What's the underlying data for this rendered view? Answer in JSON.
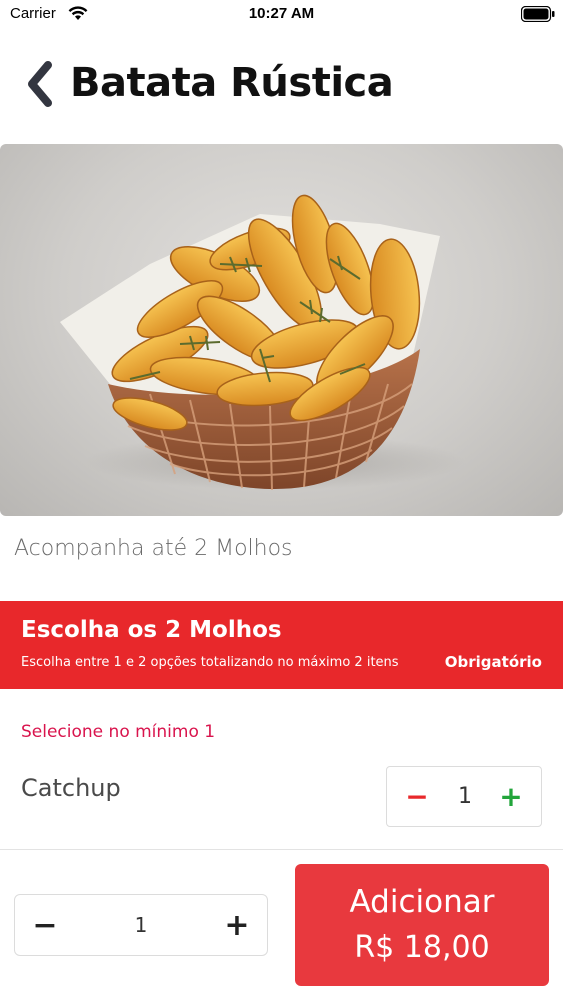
{
  "status_bar": {
    "carrier": "Carrier",
    "time": "10:27 AM",
    "icons": [
      "wifi-icon",
      "battery-icon"
    ]
  },
  "header": {
    "back_icon": "chevron-left-icon",
    "title": "Batata Rústica"
  },
  "product": {
    "image": "fried-potato-wedges-basket-photo",
    "description": "Acompanha até 2 Molhos"
  },
  "section": {
    "title": "Escolha os 2 Molhos",
    "subtitle": "Escolha entre 1 e 2 opções totalizando no máximo 2 itens",
    "badge": "Obrigatório",
    "color": "#e8282b"
  },
  "options": {
    "min_note": "Selecione no mínimo 1",
    "items": [
      {
        "name": "Catchup",
        "quantity": "1",
        "minus": "−",
        "plus": "+"
      }
    ]
  },
  "footer": {
    "quantity": "1",
    "minus": "−",
    "plus": "+",
    "add_label": "Adicionar",
    "price": "R$ 18,00",
    "accent": "#e8393e"
  }
}
